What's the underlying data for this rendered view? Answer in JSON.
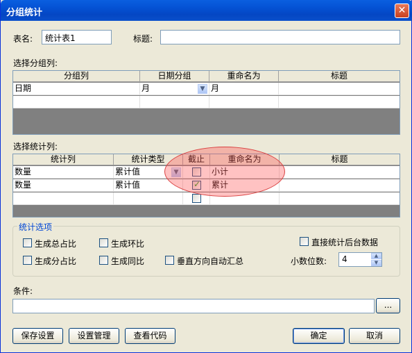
{
  "window": {
    "title": "分组统计",
    "close": "✕"
  },
  "form": {
    "table_name_label": "表名:",
    "table_name_value": "统计表1",
    "title_label": "标题:",
    "title_value": ""
  },
  "group_section": {
    "label": "选择分组列:",
    "columns": [
      "分组列",
      "日期分组",
      "重命名为",
      "标题"
    ],
    "rows": [
      {
        "col": "日期",
        "date_group": "月",
        "rename": "月",
        "title": ""
      }
    ]
  },
  "stat_section": {
    "label": "选择统计列:",
    "columns": [
      "统计列",
      "统计类型",
      "截止",
      "重命名为",
      "标题"
    ],
    "rows": [
      {
        "col": "数量",
        "type": "累计值",
        "cutoff": false,
        "rename": "小计",
        "title": ""
      },
      {
        "col": "数量",
        "type": "累计值",
        "cutoff": true,
        "rename": "累计",
        "title": ""
      }
    ]
  },
  "options": {
    "title": "统计选项",
    "total_ratio": "生成总占比",
    "ring_ratio": "生成环比",
    "part_ratio": "生成分占比",
    "yoy_ratio": "生成同比",
    "vertical_sum": "垂直方向自动汇总",
    "direct_backend": "直接统计后台数据",
    "decimals_label": "小数位数:",
    "decimals_value": "4"
  },
  "condition": {
    "label": "条件:",
    "value": "",
    "browse": "..."
  },
  "buttons": {
    "save": "保存设置",
    "manage": "设置管理",
    "view_code": "查看代码",
    "ok": "确定",
    "cancel": "取消"
  }
}
